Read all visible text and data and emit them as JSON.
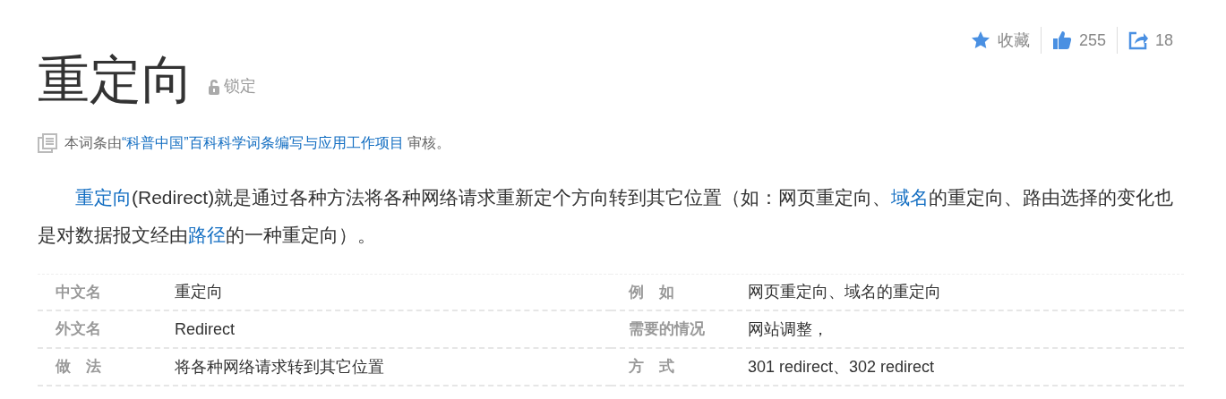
{
  "actions": [
    {
      "kind": "star",
      "label": "收藏"
    },
    {
      "kind": "thumb",
      "label": "255"
    },
    {
      "kind": "share",
      "label": "18"
    }
  ],
  "title": "重定向",
  "lock": {
    "label": "锁定"
  },
  "review": [
    {
      "text": "本词条由",
      "link": false
    },
    {
      "text": "“科普中国”百科科学词条编写与应用工作项目",
      "link": true
    },
    {
      "text": " 审核。",
      "link": false
    }
  ],
  "summary": [
    {
      "text": "重定向",
      "link": true
    },
    {
      "text": "(Redirect)就是通过各种方法将各种网络请求重新定个方向转到其它位置（如：网页重定向、",
      "link": false
    },
    {
      "text": "域名",
      "link": true
    },
    {
      "text": "的重定向、路由选择的变化也是对数据报文经由",
      "link": false
    },
    {
      "text": "路径",
      "link": true
    },
    {
      "text": "的一种重定向）。",
      "link": false
    }
  ],
  "basic_info": [
    {
      "label": "中文名",
      "value": "重定向"
    },
    {
      "label": "例　如",
      "value": "网页重定向、域名的重定向"
    },
    {
      "label": "外文名",
      "value": "Redirect"
    },
    {
      "label": "需要的情况",
      "value": "网站调整，"
    },
    {
      "label": "做　法",
      "value": "将各种网络请求转到其它位置"
    },
    {
      "label": "方　式",
      "value": "301 redirect、302 redirect"
    }
  ]
}
